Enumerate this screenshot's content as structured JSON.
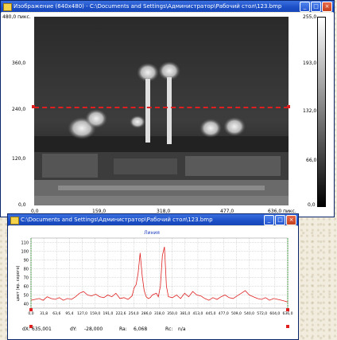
{
  "image_window": {
    "title": "Изображение (640x480) - C:\\Documents and Settings\\Администратор\\Рабочий стол\\123.bmp",
    "controls": {
      "minimize": "_",
      "maximize": "□",
      "close": "×"
    },
    "y_axis_ticks": [
      "480,0 пикс.",
      "360,0",
      "240,0",
      "120,0",
      "0,0"
    ],
    "x_axis_ticks": [
      "0,0",
      "159,0",
      "318,0",
      "477,0",
      "636,0 пикс."
    ],
    "colorbar_ticks": [
      "255,0",
      "193,0",
      "132,0",
      "66,0",
      "0,0"
    ]
  },
  "profile_window": {
    "title": "C:\\Documents and Settings\\Администратор\\Рабочий стол\\123.bmp",
    "controls": {
      "minimize": "_",
      "maximize": "□",
      "close": "×"
    },
    "legend": "Линия",
    "ylabel": "цвет (яр. серого)",
    "status": {
      "dx_label": "dX:",
      "dx_value": "635,001",
      "dy_label": "dY:",
      "dy_value": "-28,000",
      "ra_label": "Ra:",
      "ra_value": "6,068",
      "rc_label": "Rc:",
      "rc_value": "n/a"
    }
  },
  "chart_data": {
    "type": "line",
    "title": "Линия",
    "ylabel": "цвет (яр. серого)",
    "xlabel": "",
    "ylim": [
      35,
      115
    ],
    "xlim": [
      0,
      635
    ],
    "y_ticks": [
      "110",
      "100",
      "90",
      "80",
      "70",
      "60",
      "50",
      "40"
    ],
    "x_ticks": [
      "0,0",
      "31,8",
      "63,6",
      "95,4",
      "127,2",
      "159,0",
      "191,0",
      "222,6",
      "254,4",
      "286,2",
      "318,0",
      "349,8",
      "381,6",
      "413,4",
      "445,2",
      "477,0",
      "508,8",
      "540,6",
      "572,4",
      "604,2",
      "636,0"
    ],
    "x_tick_labels": [
      "0,0",
      "31,8",
      "63,6",
      "95,4",
      "127,0",
      "159,0",
      "191,0",
      "222,6",
      "254,0",
      "286,0",
      "318,0",
      "350,0",
      "381,0",
      "413,0",
      "445,0",
      "477,0",
      "509,0",
      "540,0",
      "572,0",
      "604,0",
      "636,0"
    ],
    "series": [
      {
        "color": "#e02020",
        "x": [
          0,
          10,
          20,
          30,
          40,
          50,
          60,
          70,
          80,
          90,
          100,
          110,
          120,
          130,
          140,
          150,
          160,
          170,
          180,
          190,
          200,
          210,
          220,
          230,
          240,
          250,
          255,
          260,
          265,
          270,
          275,
          280,
          285,
          290,
          295,
          300,
          310,
          315,
          320,
          325,
          330,
          335,
          340,
          350,
          360,
          370,
          380,
          390,
          400,
          410,
          420,
          430,
          440,
          450,
          460,
          470,
          480,
          490,
          500,
          510,
          520,
          530,
          540,
          550,
          560,
          570,
          580,
          590,
          600,
          610,
          620,
          635
        ],
        "y": [
          44,
          45,
          46,
          44,
          48,
          46,
          45,
          47,
          44,
          46,
          45,
          48,
          52,
          54,
          50,
          49,
          51,
          48,
          47,
          50,
          48,
          52,
          46,
          47,
          45,
          49,
          58,
          62,
          75,
          98,
          72,
          55,
          48,
          46,
          47,
          50,
          52,
          48,
          60,
          95,
          105,
          60,
          48,
          47,
          50,
          46,
          52,
          48,
          54,
          50,
          49,
          46,
          44,
          47,
          45,
          48,
          50,
          47,
          46,
          49,
          52,
          55,
          50,
          48,
          46,
          45,
          47,
          44,
          46,
          45,
          44,
          42
        ]
      }
    ]
  }
}
